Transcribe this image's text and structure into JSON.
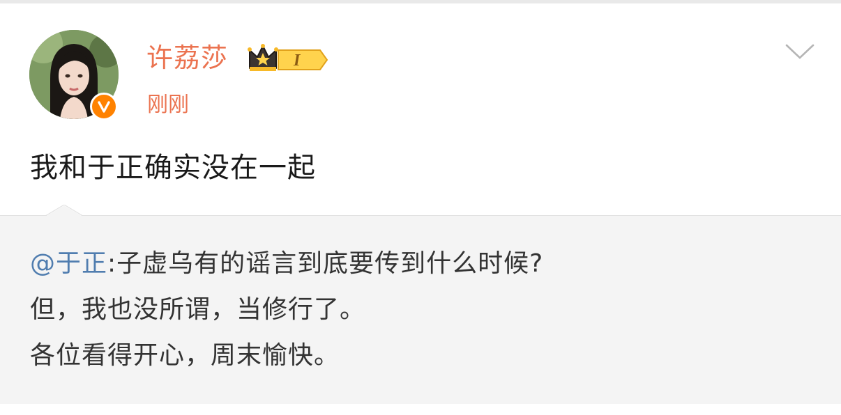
{
  "post": {
    "author": "许荔莎",
    "time": "刚刚",
    "text": "我和于正确实没在一起",
    "vip_level": "I"
  },
  "repost": {
    "mention": "@于正",
    "line1_rest": ":子虚乌有的谣言到底要传到什么时候?",
    "line2": "但，我也没所谓，当修行了。",
    "line3": "各位看得开心，周末愉快。"
  },
  "colors": {
    "name": "#eb7350",
    "link": "#507daf",
    "badge": "#ff8200",
    "repost_bg": "#f4f4f4"
  },
  "icons": [
    "vip-crown-icon",
    "verified-v-icon",
    "chevron-down-icon"
  ]
}
